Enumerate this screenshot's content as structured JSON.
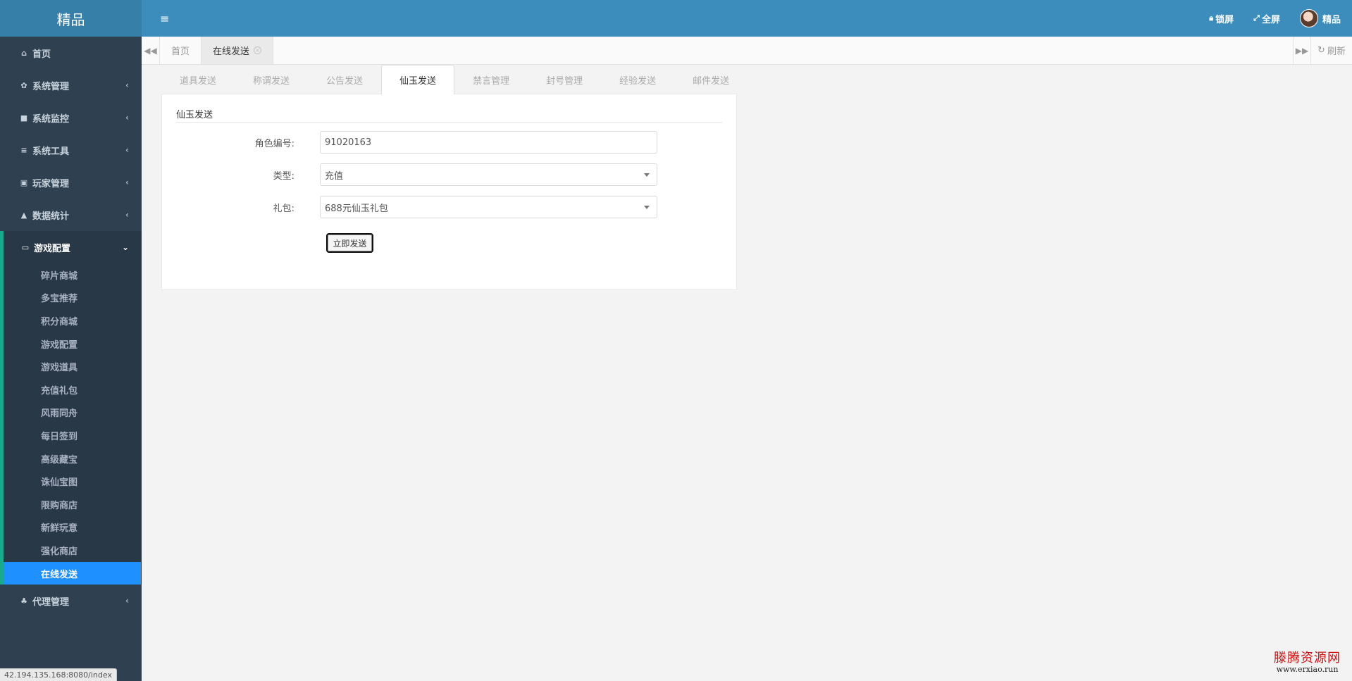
{
  "brand": "精品",
  "sidebar": {
    "items": [
      {
        "icon": "home-icon",
        "glyph": "⌂",
        "label": "首页",
        "chevron": false
      },
      {
        "icon": "gear-icon",
        "glyph": "✿",
        "label": "系统管理",
        "chevron": true
      },
      {
        "icon": "video-camera-icon",
        "glyph": "■",
        "label": "系统监控",
        "chevron": true
      },
      {
        "icon": "list-icon",
        "glyph": "≡",
        "label": "系统工具",
        "chevron": true
      },
      {
        "icon": "user-card-icon",
        "glyph": "▣",
        "label": "玩家管理",
        "chevron": true
      },
      {
        "icon": "area-chart-icon",
        "glyph": "▲",
        "label": "数据统计",
        "chevron": true
      }
    ],
    "open_group": {
      "icon": "desktop-icon",
      "glyph": "▭",
      "label": "游戏配置",
      "children": [
        "碎片商城",
        "多宝推荐",
        "积分商城",
        "游戏配置",
        "游戏道具",
        "充值礼包",
        "风雨同舟",
        "每日签到",
        "高级藏宝",
        "诛仙宝图",
        "限购商店",
        "新鲜玩意",
        "强化商店",
        "在线发送"
      ],
      "active_child": "在线发送"
    },
    "bottom_item": {
      "icon": "users-icon",
      "glyph": "♣",
      "label": "代理管理"
    }
  },
  "status_url": "42.194.135.168:8080/index",
  "topbar": {
    "lock_label": "锁屏",
    "fullscreen_label": "全屏",
    "user_name": "精品"
  },
  "page_tabs": [
    {
      "label": "首页",
      "active": false
    },
    {
      "label": "在线发送",
      "active": true
    }
  ],
  "refresh_label": "刷新",
  "func_tabs": [
    "道具发送",
    "称谓发送",
    "公告发送",
    "仙玉发送",
    "禁言管理",
    "封号管理",
    "经验发送",
    "邮件发送"
  ],
  "active_func_tab": "仙玉发送",
  "form": {
    "legend": "仙玉发送",
    "role_id_label": "角色编号:",
    "role_id_value": "91020163",
    "type_label": "类型:",
    "type_value": "充值",
    "gift_label": "礼包:",
    "gift_value": "688元仙玉礼包",
    "submit_label": "立即发送"
  },
  "watermark": {
    "cn": "滕腾资源网",
    "url": "www.erxiao.run"
  }
}
